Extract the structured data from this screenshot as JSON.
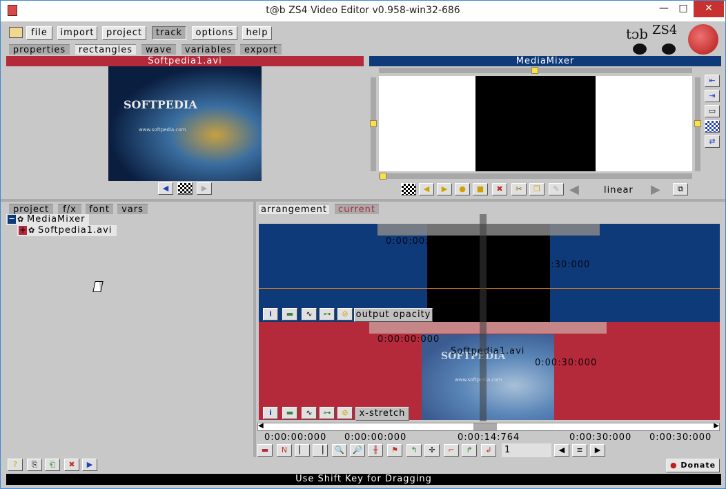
{
  "window": {
    "title": "t@b ZS4 Video Editor v0.958-win32-686",
    "min": "—",
    "max": "□",
    "close": "✕"
  },
  "menu": [
    {
      "label": "file"
    },
    {
      "label": "import"
    },
    {
      "label": "project"
    },
    {
      "label": "track"
    },
    {
      "label": "options"
    },
    {
      "label": "help"
    }
  ],
  "tabs_top": [
    {
      "label": "properties"
    },
    {
      "label": "rectangles"
    },
    {
      "label": "wave"
    },
    {
      "label": "variables"
    },
    {
      "label": "export"
    }
  ],
  "logo": {
    "text": "tɔb",
    "sub": "ZS4"
  },
  "source_panel": {
    "title": "Softpedia1.avi",
    "frame_text": "SOFTPEDIA",
    "frame_url": "www.softpedia.com"
  },
  "mixer_panel": {
    "title": "MediaMixer",
    "interp": "linear"
  },
  "tabs_left": [
    {
      "label": "project"
    },
    {
      "label": "f/x"
    },
    {
      "label": "font"
    },
    {
      "label": "vars"
    }
  ],
  "tree": [
    {
      "label": "MediaMixer",
      "toggle": "−"
    },
    {
      "label": "Softpedia1.avi",
      "toggle": "+"
    }
  ],
  "tabs_right": [
    {
      "label": "arrangement"
    },
    {
      "label": "current"
    }
  ],
  "track1": {
    "start": "0:00:00:000",
    "name": "MediaMixer",
    "end": "0:00:30:000",
    "param": "output opacity"
  },
  "track2": {
    "start": "0:00:00:000",
    "name": "Softpedia1.avi",
    "end": "0:00:30:000",
    "param": "x-stretch",
    "frame_text": "SOFTPEDIA",
    "frame_url": "www.softpedia.com"
  },
  "ruler": {
    "t1": "0:00:00:000",
    "t2": "0:00:00:000",
    "t3": "0:00:14:764",
    "t4": "0:00:30:000",
    "t5": "0:00:30:000"
  },
  "frame_input": {
    "value": "1"
  },
  "donate": {
    "label": "Donate"
  },
  "status": {
    "text": "Use Shift Key for Dragging"
  },
  "colors": {
    "red": "#b52a3a",
    "blue": "#0f3a7a",
    "bg": "#c8c8c8"
  }
}
